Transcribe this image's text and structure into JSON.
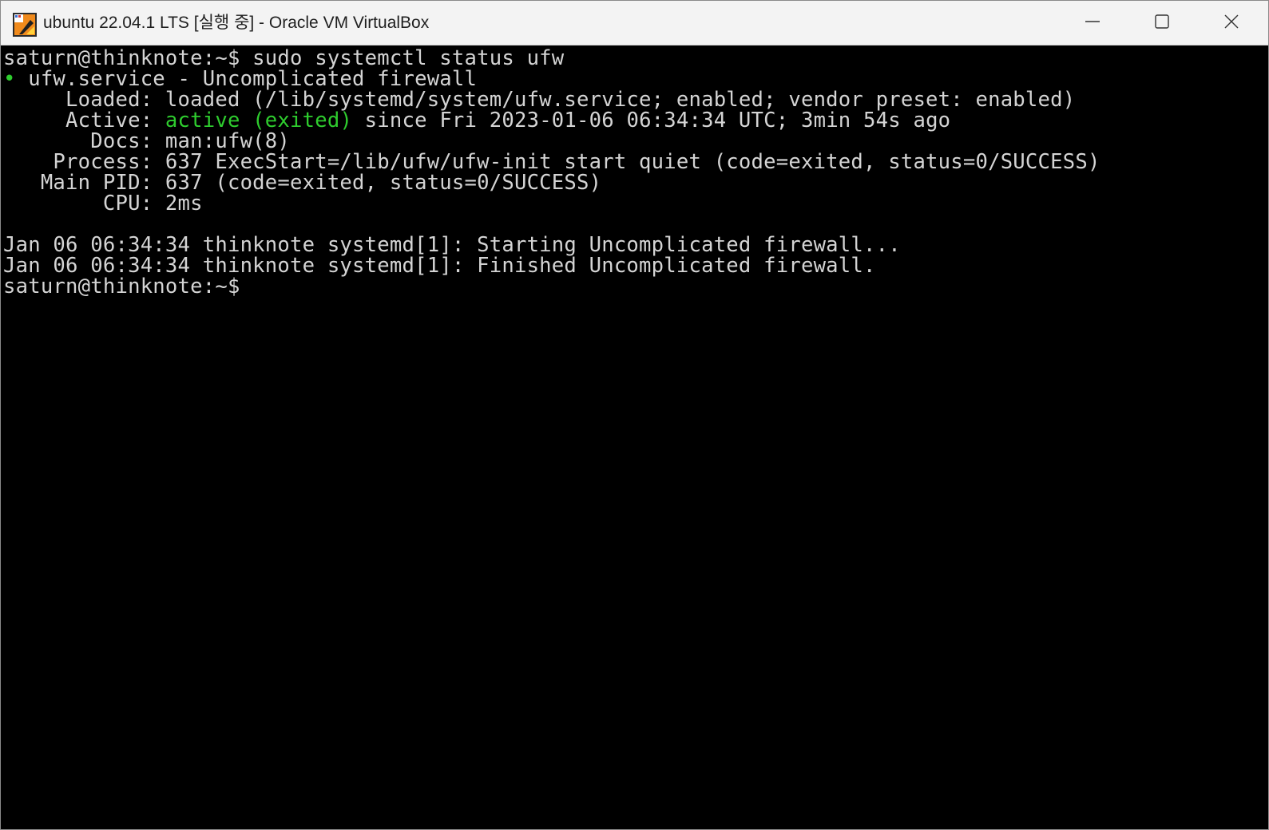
{
  "window": {
    "title": "ubuntu 22.04.1 LTS [실행 중] - Oracle VM VirtualBox",
    "icon": "virtualbox-icon",
    "controls": {
      "minimize": "minimize-icon",
      "maximize": "maximize-icon",
      "close": "close-icon"
    }
  },
  "colors": {
    "terminal_bg": "#000000",
    "terminal_fg": "#d4d4d4",
    "status_green": "#2ecc2e",
    "titlebar_bg": "#f3f3f3"
  },
  "terminal": {
    "lines": [
      {
        "segments": [
          {
            "text": "saturn@thinknote:~$ sudo systemctl status ufw",
            "color": ""
          }
        ]
      },
      {
        "segments": [
          {
            "text": "•",
            "color": "green"
          },
          {
            "text": " ufw.service - Uncomplicated firewall",
            "color": ""
          }
        ]
      },
      {
        "segments": [
          {
            "text": "     Loaded: loaded (/lib/systemd/system/ufw.service; enabled; vendor preset: enabled)",
            "color": ""
          }
        ]
      },
      {
        "segments": [
          {
            "text": "     Active: ",
            "color": ""
          },
          {
            "text": "active (exited)",
            "color": "green"
          },
          {
            "text": " since Fri 2023-01-06 06:34:34 UTC; 3min 54s ago",
            "color": ""
          }
        ]
      },
      {
        "segments": [
          {
            "text": "       Docs: man:ufw(8)",
            "color": ""
          }
        ]
      },
      {
        "segments": [
          {
            "text": "    Process: 637 ExecStart=/lib/ufw/ufw-init start quiet (code=exited, status=0/SUCCESS)",
            "color": ""
          }
        ]
      },
      {
        "segments": [
          {
            "text": "   Main PID: 637 (code=exited, status=0/SUCCESS)",
            "color": ""
          }
        ]
      },
      {
        "segments": [
          {
            "text": "        CPU: 2ms",
            "color": ""
          }
        ]
      },
      {
        "segments": [
          {
            "text": "",
            "color": ""
          }
        ]
      },
      {
        "segments": [
          {
            "text": "Jan 06 06:34:34 thinknote systemd[1]: Starting Uncomplicated firewall...",
            "color": ""
          }
        ]
      },
      {
        "segments": [
          {
            "text": "Jan 06 06:34:34 thinknote systemd[1]: Finished Uncomplicated firewall.",
            "color": ""
          }
        ]
      },
      {
        "segments": [
          {
            "text": "saturn@thinknote:~$",
            "color": ""
          }
        ]
      }
    ]
  }
}
